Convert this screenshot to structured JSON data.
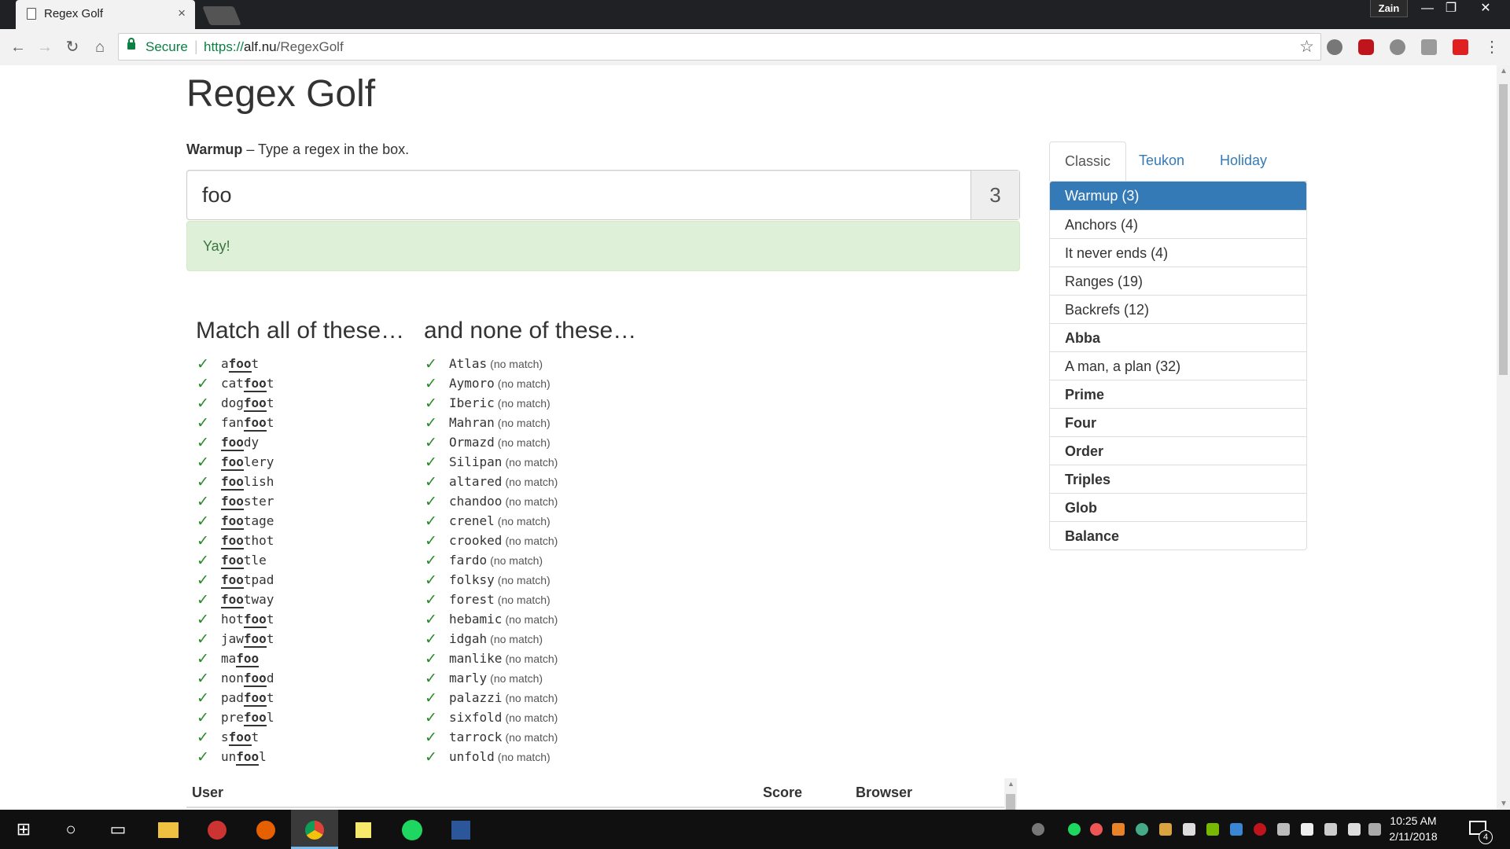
{
  "browser": {
    "tab_title": "Regex Golf",
    "tab_close": "×",
    "profile_name": "Zain",
    "secure_label": "Secure",
    "url_scheme": "https://",
    "url_host": "alf.nu",
    "url_path": "/RegexGolf",
    "window_controls": {
      "minimize": "—",
      "restore": "❐",
      "close": "✕"
    }
  },
  "page": {
    "title": "Regex Golf",
    "level_name": "Warmup",
    "instruction": " – Type a regex in the box.",
    "regex_value": "foo",
    "score": "3",
    "success_message": "Yay!",
    "match_heading": "Match all of these…",
    "nomatch_heading": "and none of these…",
    "no_match_label": "(no match)",
    "match_words": [
      {
        "pre": "a",
        "hl": "foo",
        "post": "t"
      },
      {
        "pre": "cat",
        "hl": "foo",
        "post": "t"
      },
      {
        "pre": "dog",
        "hl": "foo",
        "post": "t"
      },
      {
        "pre": "fan",
        "hl": "foo",
        "post": "t"
      },
      {
        "pre": "",
        "hl": "foo",
        "post": "dy"
      },
      {
        "pre": "",
        "hl": "foo",
        "post": "lery"
      },
      {
        "pre": "",
        "hl": "foo",
        "post": "lish"
      },
      {
        "pre": "",
        "hl": "foo",
        "post": "ster"
      },
      {
        "pre": "",
        "hl": "foo",
        "post": "tage"
      },
      {
        "pre": "",
        "hl": "foo",
        "post": "thot"
      },
      {
        "pre": "",
        "hl": "foo",
        "post": "tle"
      },
      {
        "pre": "",
        "hl": "foo",
        "post": "tpad"
      },
      {
        "pre": "",
        "hl": "foo",
        "post": "tway"
      },
      {
        "pre": "hot",
        "hl": "foo",
        "post": "t"
      },
      {
        "pre": "jaw",
        "hl": "foo",
        "post": "t"
      },
      {
        "pre": "ma",
        "hl": "foo",
        "post": ""
      },
      {
        "pre": "non",
        "hl": "foo",
        "post": "d"
      },
      {
        "pre": "pad",
        "hl": "foo",
        "post": "t"
      },
      {
        "pre": "pre",
        "hl": "foo",
        "post": "l"
      },
      {
        "pre": "s",
        "hl": "foo",
        "post": "t"
      },
      {
        "pre": "un",
        "hl": "foo",
        "post": "l"
      }
    ],
    "nomatch_words": [
      "Atlas",
      "Aymoro",
      "Iberic",
      "Mahran",
      "Ormazd",
      "Silipan",
      "altared",
      "chandoo",
      "crenel",
      "crooked",
      "fardo",
      "folksy",
      "forest",
      "hebamic",
      "idgah",
      "manlike",
      "marly",
      "palazzi",
      "sixfold",
      "tarrock",
      "unfold"
    ],
    "table_headers": {
      "user": "User",
      "score": "Score",
      "browser": "Browser"
    }
  },
  "level_tabs": [
    "Classic",
    "Teukon",
    "Holiday"
  ],
  "levels": [
    {
      "label": "Warmup (3)",
      "state": "active"
    },
    {
      "label": "Anchors (4)",
      "state": "solved"
    },
    {
      "label": "It never ends (4)",
      "state": "solved"
    },
    {
      "label": "Ranges (19)",
      "state": "solved"
    },
    {
      "label": "Backrefs (12)",
      "state": "solved"
    },
    {
      "label": "Abba",
      "state": "locked"
    },
    {
      "label": "A man, a plan (32)",
      "state": "solved"
    },
    {
      "label": "Prime",
      "state": "locked"
    },
    {
      "label": "Four",
      "state": "locked"
    },
    {
      "label": "Order",
      "state": "locked"
    },
    {
      "label": "Triples",
      "state": "locked"
    },
    {
      "label": "Glob",
      "state": "locked"
    },
    {
      "label": "Balance",
      "state": "locked"
    }
  ],
  "taskbar": {
    "time": "10:25 AM",
    "date": "2/11/2018",
    "notification_count": "4"
  },
  "colors": {
    "accent": "#337ab7",
    "success_bg": "#dff0d8",
    "success_text": "#3c763d",
    "check": "#2a8a2a",
    "secure_green": "#0b8043"
  }
}
